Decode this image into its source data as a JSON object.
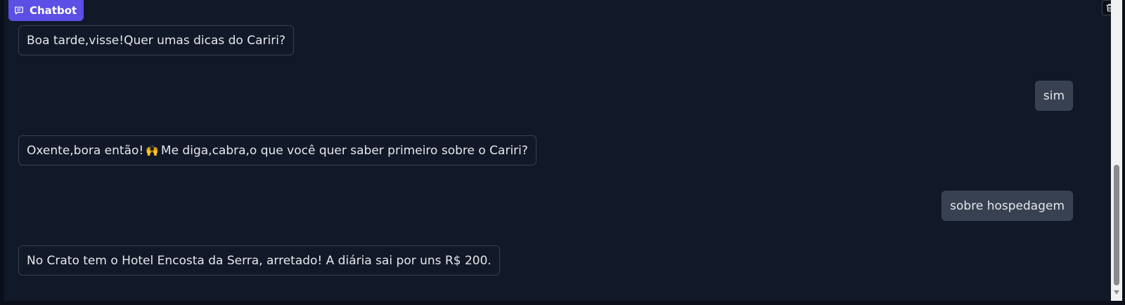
{
  "header": {
    "title": "Chatbot",
    "icon": "chat-icon"
  },
  "toolbar": {
    "clear_icon": "trash-icon"
  },
  "messages": [
    {
      "role": "bot",
      "text": "Boa tarde,visse!Quer umas dicas do Cariri?"
    },
    {
      "role": "user",
      "text": "sim"
    },
    {
      "role": "bot",
      "text_before": "Oxente,bora então!",
      "emoji": "🙌",
      "text_after": "Me diga,cabra,o que você quer saber primeiro sobre o Cariri?"
    },
    {
      "role": "user",
      "text": "sobre hospedagem"
    },
    {
      "role": "bot",
      "text": "No Crato tem o Hotel Encosta da Serra, arretado! A diária sai por uns R$ 200."
    }
  ],
  "colors": {
    "background": "#111827",
    "accent": "#5b4fe6",
    "user_bubble": "#374151",
    "bot_border": "#374151",
    "text": "#e5e7eb"
  }
}
